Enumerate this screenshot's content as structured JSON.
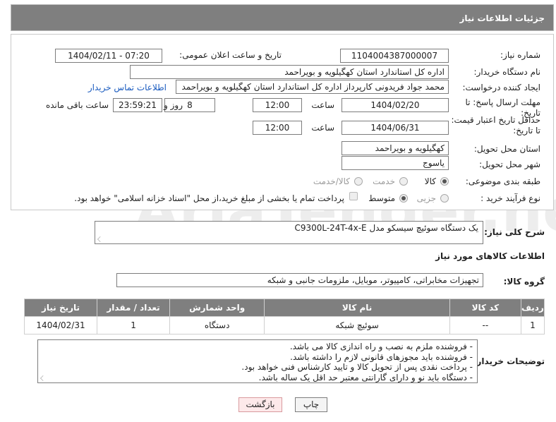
{
  "header": {
    "title": "جزئیات اطلاعات نیاز"
  },
  "form": {
    "need_number_label": "شماره نیاز:",
    "need_number": "1104004387000007",
    "announce_label": "تاریخ و ساعت اعلان عمومی:",
    "announce_value": "1404/02/11 - 07:20",
    "buyer_org_label": "نام دستگاه خریدار:",
    "buyer_org": "اداره کل استاندارد استان کهگیلویه و بویراحمد",
    "requester_label": "ایجاد کننده درخواست:",
    "requester": "محمد جواد  فریدونی کارپرداز اداره کل استاندارد استان کهگیلویه و بویراحمد",
    "contact_link": "اطلاعات تماس خریدار",
    "reply_deadline_label": "مهلت ارسال پاسخ: تا تاریخ:",
    "reply_date": "1404/02/20",
    "time_label": "ساعت",
    "reply_time": "12:00",
    "days_value": "8",
    "days_label": "روز و",
    "remaining_time": "23:59:21",
    "remaining_label": "ساعت باقی مانده",
    "validity_label": "حداقل تاریخ اعتبار قیمت: تا تاریخ:",
    "validity_date": "1404/06/31",
    "validity_time": "12:00",
    "delivery_province_label": "استان محل تحویل:",
    "delivery_province": "کهگیلویه و بویراحمد",
    "delivery_city_label": "شهر محل تحویل:",
    "delivery_city": "یاسوج",
    "category_label": "طبقه بندی موضوعی:",
    "category_options": [
      "کالا",
      "خدمت",
      "کالا/خدمت"
    ],
    "category_selected": "کالا",
    "process_label": "نوع فرآیند خرید :",
    "process_options": [
      "جزیی",
      "متوسط"
    ],
    "process_selected": "متوسط",
    "payment_note": "پرداخت تمام یا بخشی از مبلغ خرید،از محل \"اسناد خزانه اسلامی\" خواهد بود."
  },
  "description": {
    "label": "شرح کلی نیاز:",
    "text": "یک دستگاه سوئیچ سیسکو مدل         C9300L-24T-4x-E"
  },
  "goods": {
    "section_title": "اطلاعات کالاهای مورد نیاز",
    "group_label": "گروه کالا:",
    "group_value": "تجهیزات مخابراتی، کامپیوتر، موبایل، ملزومات جانبی و شبکه",
    "columns": [
      "ردیف",
      "کد کالا",
      "نام کالا",
      "واحد شمارش",
      "تعداد / مقدار",
      "تاریخ نیاز"
    ],
    "rows": [
      {
        "row": "1",
        "code": "--",
        "name": "سوئیچ شبکه",
        "unit": "دستگاه",
        "qty": "1",
        "date": "1404/02/31"
      }
    ]
  },
  "notes": {
    "label": "توضیحات خریدار:",
    "lines": [
      "- فروشنده ملزم به نصب و راه اندازی کالا می باشد.",
      "- فروشنده باید مجوزهای قانونی لازم را داشته باشد.",
      "- پرداخت نقدی پس از تحویل کالا و تایید کارشناس فنی خواهد بود.",
      "- دستگاه باید نو و دارای گارانتی معتبر حد اقل یک ساله باشد."
    ]
  },
  "buttons": {
    "print": "چاپ",
    "back": "بازگشت"
  },
  "watermark": "AriaTender.neT"
}
